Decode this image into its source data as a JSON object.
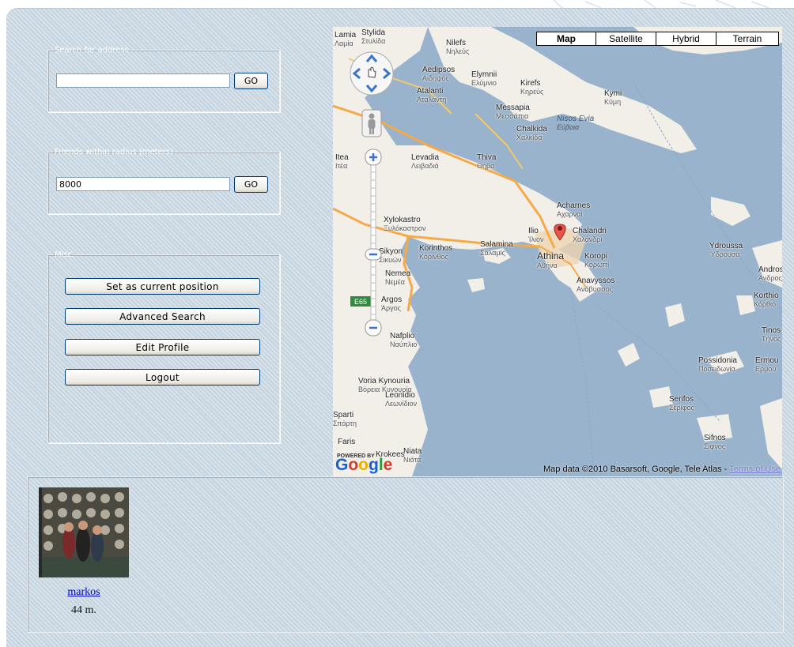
{
  "search": {
    "legend": "Search for address",
    "value": "",
    "button": "GO"
  },
  "friends_radius": {
    "legend": "Friends within radius (meters)",
    "value": "8000",
    "button": "GO"
  },
  "misc": {
    "legend": "Misc.",
    "buttons": [
      "Set as current position",
      "Advanced Search",
      "Edit Profile",
      "Logout"
    ]
  },
  "map": {
    "types": [
      "Map",
      "Satellite",
      "Hybrid",
      "Terrain"
    ],
    "selected_type": "Map",
    "attribution": "Map data ©2010 Basarsoft, Google, Tele Atlas -",
    "terms_link": "Terms of Use",
    "powered_by": "POWERED BY",
    "google_logo": "Google",
    "route_shield": "E65",
    "labels": [
      {
        "name": "Lamia",
        "greek": "Λαμία"
      },
      {
        "name": "Stylida",
        "greek": "Στυλίδα"
      },
      {
        "name": "Nilefs",
        "greek": "Νηλεύς"
      },
      {
        "name": "Aedipsos",
        "greek": "Αιδηψός"
      },
      {
        "name": "Elymnii",
        "greek": "Ελύμνιο"
      },
      {
        "name": "Kirefs",
        "greek": "Κηρεύς"
      },
      {
        "name": "Kymi",
        "greek": "Κύμη"
      },
      {
        "name": "Atalanti",
        "greek": "Αταλάντη"
      },
      {
        "name": "Messapia",
        "greek": "Μεσσάπια"
      },
      {
        "name": "Nisos Evia",
        "greek": "Εύβοια"
      },
      {
        "name": "Chalkida",
        "greek": "Χαλκίδα"
      },
      {
        "name": "Itea",
        "greek": "Ιτέα"
      },
      {
        "name": "Levadia",
        "greek": "Λειβαδιά"
      },
      {
        "name": "Thiva",
        "greek": "Θήβα"
      },
      {
        "name": "Acharnes",
        "greek": "Αχαρναί"
      },
      {
        "name": "Xylokastro",
        "greek": "Ξυλόκαστρον"
      },
      {
        "name": "Ilio",
        "greek": "Ίλιον"
      },
      {
        "name": "Chalandri",
        "greek": "Χαλάνδρι"
      },
      {
        "name": "Sikyon",
        "greek": "Σικυών"
      },
      {
        "name": "Korinthos",
        "greek": "Κόρινθος"
      },
      {
        "name": "Salamina",
        "greek": "Σαλαμίς"
      },
      {
        "name": "Athina",
        "greek": "Αθήνα"
      },
      {
        "name": "Koropi",
        "greek": "Κορωπί"
      },
      {
        "name": "Ydroussa",
        "greek": "Ύδρουσα"
      },
      {
        "name": "Nemea",
        "greek": "Νεμέα"
      },
      {
        "name": "Argos",
        "greek": "Άργος"
      },
      {
        "name": "Anavyssos",
        "greek": "Ανάβυσσος"
      },
      {
        "name": "Nafplio",
        "greek": "Ναύπλιο"
      },
      {
        "name": "Voria Kynouria",
        "greek": "Βόρεια Κυνουρία"
      },
      {
        "name": "Leonidio",
        "greek": "Λεωνίδιον"
      },
      {
        "name": "Sparti",
        "greek": "Σπάρτη"
      },
      {
        "name": "Faris",
        "greek": ""
      },
      {
        "name": "Krokees",
        "greek": ""
      },
      {
        "name": "Niata",
        "greek": "Νιάτα"
      },
      {
        "name": "Possidonia",
        "greek": "Ποσειδωνία"
      },
      {
        "name": "Ermou",
        "greek": "Ερμου"
      },
      {
        "name": "Serifos",
        "greek": "Σέριφος"
      },
      {
        "name": "Sifnos",
        "greek": "Σίφνος"
      },
      {
        "name": "Korthio",
        "greek": "Κόρθιο"
      },
      {
        "name": "Tinos",
        "greek": "Τήνος"
      },
      {
        "name": "Andros",
        "greek": "Άνδρος"
      }
    ]
  },
  "friend": {
    "name": "markos",
    "distance": "44 m."
  },
  "colors": {
    "panel_bg": "#c6d5df",
    "sea": "#99b3cc",
    "land": "#f2efe9",
    "marker": "#e8554a",
    "link": "#0000cc"
  }
}
